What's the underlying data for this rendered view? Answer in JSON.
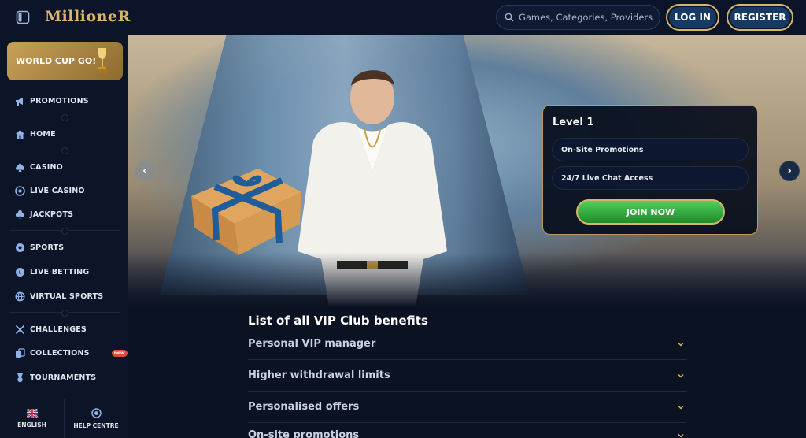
{
  "header": {
    "logo": "MillioneR",
    "search_placeholder": "Games, Categories, Providers",
    "login_label": "LOG IN",
    "register_label": "REGISTER"
  },
  "sidebar": {
    "promo_banner": "WORLD CUP GO!",
    "items": [
      {
        "label": "PROMOTIONS",
        "icon": "megaphone-icon"
      },
      {
        "label": "HOME",
        "icon": "home-icon"
      },
      {
        "label": "CASINO",
        "icon": "spade-icon"
      },
      {
        "label": "LIVE CASINO",
        "icon": "chip-icon"
      },
      {
        "label": "JACKPOTS",
        "icon": "clover-icon"
      },
      {
        "label": "SPORTS",
        "icon": "ball-icon"
      },
      {
        "label": "LIVE BETTING",
        "icon": "live-icon"
      },
      {
        "label": "VIRTUAL SPORTS",
        "icon": "globe-icon"
      },
      {
        "label": "CHALLENGES",
        "icon": "crossed-swords-icon"
      },
      {
        "label": "COLLECTIONS",
        "icon": "cards-icon",
        "badge": "new"
      },
      {
        "label": "TOURNAMENTS",
        "icon": "medal-icon"
      }
    ],
    "language_label": "ENGLISH",
    "help_label": "HELP CENTRE"
  },
  "hero": {
    "level_title": "Level 1",
    "perks": [
      "On-Site Promotions",
      "24/7 Live Chat Access"
    ],
    "join_label": "JOIN NOW"
  },
  "benefits": {
    "title": "List of all VIP Club benefits",
    "items": [
      "Personal VIP manager",
      "Higher withdrawal limits",
      "Personalised offers",
      "On-site promotions"
    ]
  },
  "colors": {
    "background": "#0b1222",
    "accent_gold": "#d6b56a",
    "button_blue": "#163a63",
    "join_green": "#2fae3c"
  }
}
